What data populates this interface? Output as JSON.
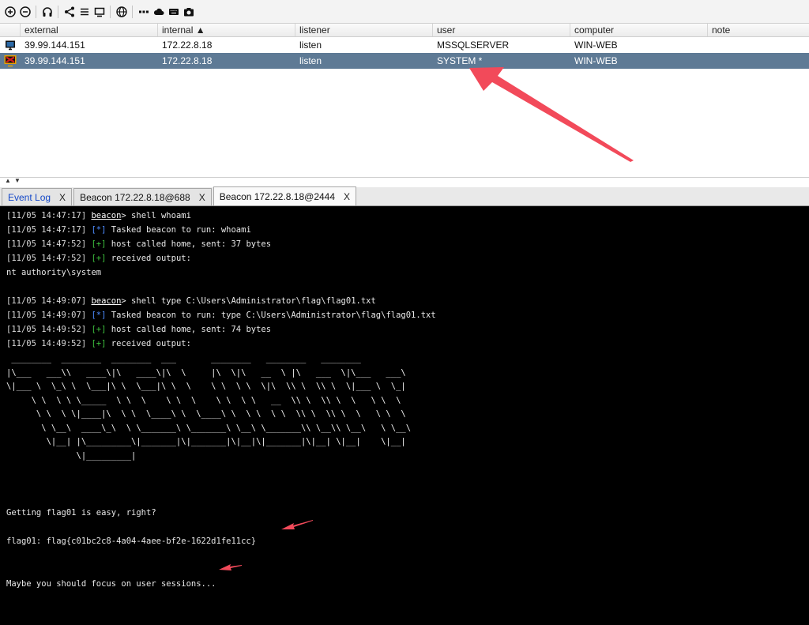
{
  "toolbar": {
    "buttons": [
      "plus-circle-icon",
      "minus-circle-icon",
      "headphones-icon",
      "share-icon",
      "list-icon",
      "monitor-icon",
      "globe-icon",
      "dots-icon",
      "cloud-icon",
      "keyboard-icon",
      "camera-icon"
    ]
  },
  "table": {
    "headers": [
      "external",
      "internal ▲",
      "listener",
      "user",
      "computer",
      "note"
    ],
    "rows": [
      {
        "external": "39.99.144.151",
        "internal": "172.22.8.18",
        "listener": "listen",
        "user": "MSSQLSERVER",
        "computer": "WIN-WEB",
        "note": "",
        "selected": false
      },
      {
        "external": "39.99.144.151",
        "internal": "172.22.8.18",
        "listener": "listen",
        "user": "SYSTEM *",
        "computer": "WIN-WEB",
        "note": "",
        "selected": true
      }
    ]
  },
  "splitter": {
    "up": "▲",
    "down": "▼"
  },
  "tabs": [
    {
      "label": "Event Log",
      "close": "X"
    },
    {
      "label": "Beacon 172.22.8.18@688",
      "close": "X"
    },
    {
      "label": "Beacon 172.22.8.18@2444",
      "close": "X"
    }
  ],
  "console": {
    "l1": {
      "ts": "[11/05 14:47:17] ",
      "prompt": "beacon",
      "text": "> shell whoami"
    },
    "l2": {
      "ts": "[11/05 14:47:17] ",
      "mark": "[*]",
      "text": " Tasked beacon to run: whoami"
    },
    "l3": {
      "ts": "[11/05 14:47:52] ",
      "mark": "[+]",
      "text": " host called home, sent: 37 bytes"
    },
    "l4": {
      "ts": "[11/05 14:47:52] ",
      "mark": "[+]",
      "text": " received output:"
    },
    "l5": "nt authority\\system",
    "l6": {
      "ts": "[11/05 14:49:07] ",
      "prompt": "beacon",
      "text": "> shell type C:\\Users\\Administrator\\flag\\flag01.txt"
    },
    "l7": {
      "ts": "[11/05 14:49:07] ",
      "mark": "[*]",
      "text": " Tasked beacon to run: type C:\\Users\\Administrator\\flag\\flag01.txt"
    },
    "l8": {
      "ts": "[11/05 14:49:52] ",
      "mark": "[+]",
      "text": " host called home, sent: 74 bytes"
    },
    "l9": {
      "ts": "[11/05 14:49:52] ",
      "mark": "[+]",
      "text": " received output:"
    },
    "ascii": " ________  ________  ________  ___       ________   ________   ________\n|\\___   ___\\\\   ____\\|\\   ____\\|\\  \\     |\\  \\|\\   __  \\ |\\   ___  \\|\\___   ___\\\n\\|___ \\  \\_\\ \\  \\___|\\ \\  \\___|\\ \\  \\    \\ \\  \\ \\  \\|\\  \\\\ \\  \\\\ \\  \\|___ \\  \\_|\n     \\ \\  \\ \\ \\_____  \\ \\  \\    \\ \\  \\    \\ \\  \\ \\   __  \\\\ \\  \\\\ \\  \\   \\ \\  \\\n      \\ \\  \\ \\|____|\\  \\ \\  \\____\\ \\  \\____\\ \\  \\ \\  \\ \\  \\\\ \\  \\\\ \\  \\   \\ \\  \\\n       \\ \\__\\  ____\\_\\  \\ \\_______\\ \\_______\\ \\__\\ \\_______\\\\ \\__\\\\ \\__\\   \\ \\__\\\n        \\|__| |\\_________\\|_______|\\|_______|\\|__|\\|_______|\\|__| \\|__|    \\|__|\n              \\|_________|",
    "msg1": "Getting flag01 is easy, right?",
    "flag": "flag01: flag{c01bc2c8-4a04-4aee-bf2e-1622d1fe11cc}",
    "msg2": "Maybe you should focus on user sessions..."
  },
  "annotation_color": "#f24a5a"
}
